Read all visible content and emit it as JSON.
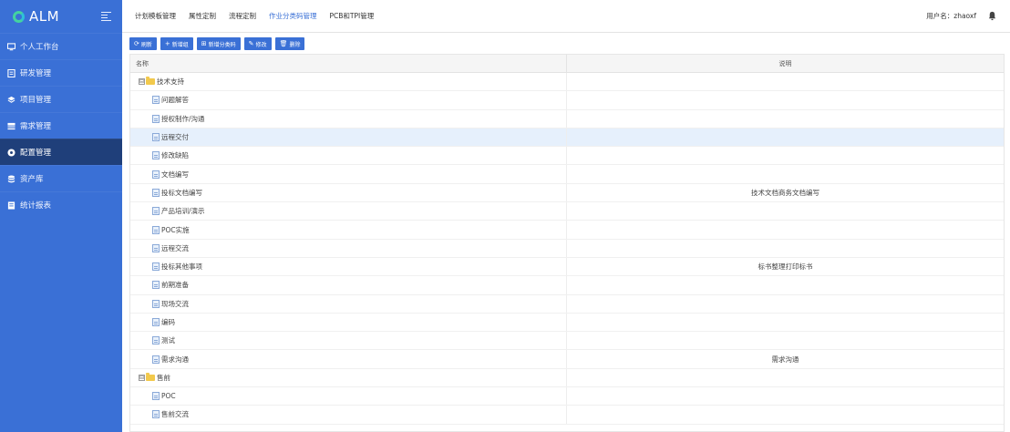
{
  "app": {
    "logo_text": "ALM"
  },
  "sidebar": {
    "items": [
      {
        "label": "个人工作台",
        "icon": "monitor-icon",
        "active": false
      },
      {
        "label": "研发管理",
        "icon": "code-icon",
        "active": false
      },
      {
        "label": "项目管理",
        "icon": "layers-icon",
        "active": false
      },
      {
        "label": "需求管理",
        "icon": "user-group-icon",
        "active": false
      },
      {
        "label": "配置管理",
        "icon": "gear-circle-icon",
        "active": true
      },
      {
        "label": "资产库",
        "icon": "database-icon",
        "active": false
      },
      {
        "label": "统计报表",
        "icon": "report-icon",
        "active": false
      }
    ]
  },
  "topnav": {
    "tabs": [
      {
        "label": "计划模板管理",
        "active": false
      },
      {
        "label": "属性定制",
        "active": false
      },
      {
        "label": "流程定制",
        "active": false
      },
      {
        "label": "作业分类码管理",
        "active": true
      },
      {
        "label": "PCB和TPI管理",
        "active": false
      }
    ],
    "user_label": "用户名：zhaoxf"
  },
  "toolbar": {
    "buttons": [
      {
        "label": "刷新",
        "icon": "refresh-icon",
        "glyph": "⟳"
      },
      {
        "label": "新增组",
        "icon": "plus-icon",
        "glyph": "+"
      },
      {
        "label": "新增分类码",
        "icon": "add-box-icon",
        "glyph": "⊞"
      },
      {
        "label": "修改",
        "icon": "edit-icon",
        "glyph": "✎"
      },
      {
        "label": "删除",
        "icon": "trash-icon",
        "glyph": "🗑"
      }
    ]
  },
  "grid": {
    "columns": {
      "name": "名称",
      "desc": "说明"
    },
    "rows": [
      {
        "name": "技术支持",
        "desc": "",
        "type": "group",
        "expander": "⊟"
      },
      {
        "name": "问题解答",
        "desc": "",
        "type": "item"
      },
      {
        "name": "授权制作/沟通",
        "desc": "",
        "type": "item"
      },
      {
        "name": "远程交付",
        "desc": "",
        "type": "item",
        "selected": true
      },
      {
        "name": "修改缺陷",
        "desc": "",
        "type": "item"
      },
      {
        "name": "文档编写",
        "desc": "",
        "type": "item"
      },
      {
        "name": "投标文档编写",
        "desc": "技术文档商务文档编写",
        "type": "item"
      },
      {
        "name": "产品培训/演示",
        "desc": "",
        "type": "item"
      },
      {
        "name": "POC实施",
        "desc": "",
        "type": "item"
      },
      {
        "name": "远程交流",
        "desc": "",
        "type": "item"
      },
      {
        "name": "投标其他事项",
        "desc": "标书整理打印标书",
        "type": "item"
      },
      {
        "name": "前期准备",
        "desc": "",
        "type": "item"
      },
      {
        "name": "现场交流",
        "desc": "",
        "type": "item"
      },
      {
        "name": "编码",
        "desc": "",
        "type": "item"
      },
      {
        "name": "测试",
        "desc": "",
        "type": "item"
      },
      {
        "name": "需求沟通",
        "desc": "需求沟通",
        "type": "item"
      },
      {
        "name": "售前",
        "desc": "",
        "type": "group",
        "expander": "⊟"
      },
      {
        "name": "POC",
        "desc": "",
        "type": "item"
      },
      {
        "name": "售前交流",
        "desc": "",
        "type": "item"
      }
    ]
  },
  "colors": {
    "accent": "#3a70d6",
    "sidebar_active": "#1f3f7a",
    "selected_row": "#e6f0fc",
    "active_tab": "#3a70d6"
  }
}
